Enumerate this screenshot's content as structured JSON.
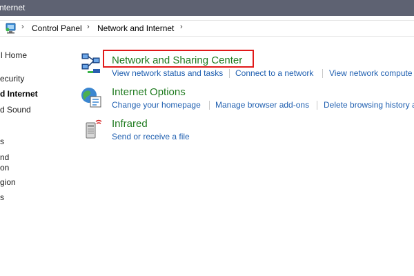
{
  "window": {
    "title": "nternet"
  },
  "address": {
    "icon": "control-panel-icon",
    "crumbs": [
      "Control Panel",
      "Network and Internet"
    ]
  },
  "sidebar": {
    "items": [
      {
        "label": "l Home"
      },
      {
        "label": "ecurity"
      },
      {
        "label": "d Internet"
      },
      {
        "label": "d Sound"
      },
      {
        "label": "s"
      },
      {
        "label": "nd"
      },
      {
        "label": "on"
      },
      {
        "label": "gion"
      },
      {
        "label": "s"
      }
    ]
  },
  "categories": [
    {
      "title": "Network and Sharing Center",
      "icon": "network-icon",
      "highlight_color": "#e11919",
      "links": [
        "View network status and tasks",
        "Connect to a network",
        "View network compute"
      ]
    },
    {
      "title": "Internet Options",
      "icon": "internet-options-icon",
      "links": [
        "Change your homepage",
        "Manage browser add-ons",
        "Delete browsing history a"
      ]
    },
    {
      "title": "Infrared",
      "icon": "infrared-icon",
      "links": [
        "Send or receive a file"
      ]
    }
  ],
  "colors": {
    "title_green": "#1e7a1e",
    "link_blue": "#1f5fb0",
    "titlebar": "#5e6272"
  }
}
